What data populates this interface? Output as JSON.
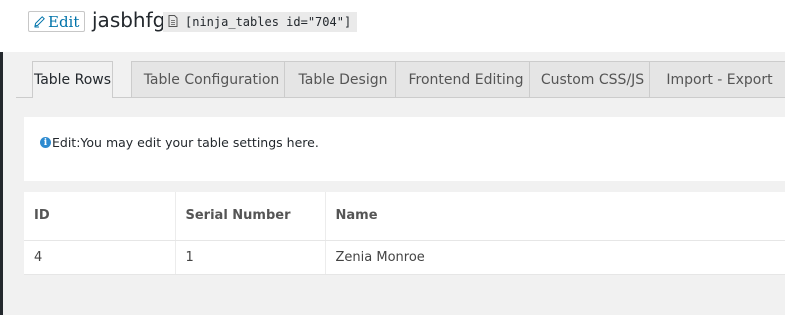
{
  "header": {
    "edit_label": "Edit",
    "table_title": "jasbhfg",
    "shortcode": "[ninja_tables id=\"704\"]"
  },
  "tabs": [
    {
      "label": "Table Rows",
      "active": true
    },
    {
      "label": "Table Configuration",
      "active": false
    },
    {
      "label": "Table Design",
      "active": false
    },
    {
      "label": "Frontend Editing",
      "active": false
    },
    {
      "label": "Custom CSS/JS",
      "active": false
    },
    {
      "label": "Import - Export",
      "active": false
    }
  ],
  "notice": {
    "prefix": "Edit:",
    "text": "You may edit your table settings here."
  },
  "table": {
    "columns": [
      "ID",
      "Serial Number",
      "Name"
    ],
    "rows": [
      [
        "4",
        "1",
        "Zenia Monroe"
      ]
    ]
  },
  "colors": {
    "link": "#0073aa",
    "info": "#2e8bd0",
    "background": "#f1f1f1"
  }
}
